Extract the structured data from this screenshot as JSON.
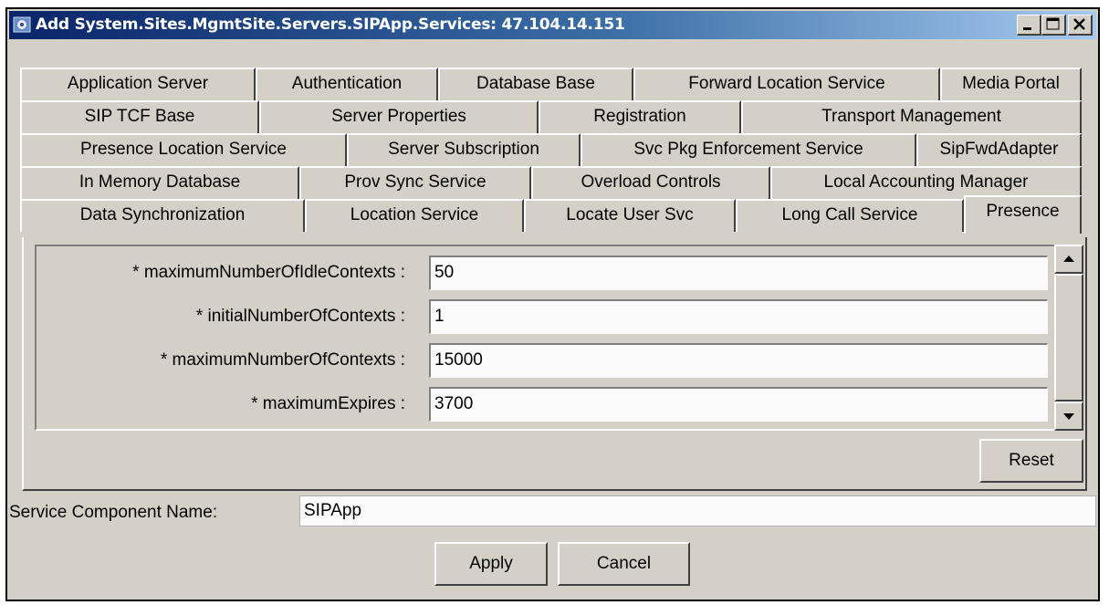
{
  "window": {
    "title": "Add System.Sites.MgmtSite.Servers.SIPApp.Services: 47.104.14.151"
  },
  "tabs": {
    "row1": [
      "Application Server",
      "Authentication",
      "Database Base",
      "Forward Location Service",
      "Media Portal"
    ],
    "row2": [
      "SIP TCF Base",
      "Server Properties",
      "Registration",
      "Transport Management"
    ],
    "row3": [
      "Presence Location Service",
      "Server Subscription",
      "Svc Pkg Enforcement Service",
      "SipFwdAdapter"
    ],
    "row4": [
      "In Memory Database",
      "Prov Sync Service",
      "Overload Controls",
      "Local Accounting Manager"
    ],
    "row5": [
      "Data Synchronization",
      "Location Service",
      "Locate User Svc",
      "Long Call Service",
      "Presence"
    ],
    "selected": "Presence"
  },
  "fields": [
    {
      "label": "* maximumNumberOfIdleContexts :",
      "value": "50"
    },
    {
      "label": "* initialNumberOfContexts :",
      "value": "1"
    },
    {
      "label": "* maximumNumberOfContexts :",
      "value": "15000"
    },
    {
      "label": "* maximumExpires :",
      "value": "3700"
    }
  ],
  "buttons": {
    "reset": "Reset",
    "apply": "Apply",
    "cancel": "Cancel"
  },
  "service_component": {
    "label": "Service Component Name:",
    "value": "SIPApp"
  }
}
